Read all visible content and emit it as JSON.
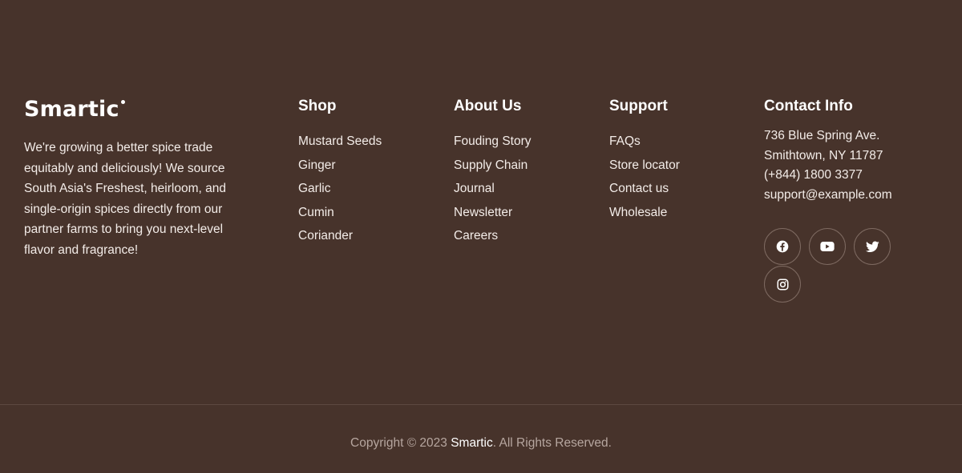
{
  "brand": {
    "logo_text": "Smartic",
    "description": "We're growing a better spice trade equitably and deliciously! We source South Asia's Freshest, heirloom, and single-origin spices directly from our partner farms to bring you next-level flavor and fragrance!"
  },
  "shop": {
    "title": "Shop",
    "items": [
      "Mustard Seeds",
      "Ginger",
      "Garlic",
      "Cumin",
      "Coriander"
    ]
  },
  "about": {
    "title": "About Us",
    "items": [
      "Fouding Story",
      "Supply Chain",
      "Journal",
      "Newsletter",
      "Careers"
    ]
  },
  "support": {
    "title": "Support",
    "items": [
      "FAQs",
      "Store locator",
      "Contact us",
      "Wholesale"
    ]
  },
  "contact": {
    "title": "Contact Info",
    "address_line1": "736 Blue Spring Ave.",
    "address_line2": "Smithtown, NY 11787",
    "phone": "(+844) 1800 3377",
    "email": "support@example.com"
  },
  "social": [
    {
      "icon": "facebook-icon"
    },
    {
      "icon": "youtube-icon"
    },
    {
      "icon": "twitter-icon"
    },
    {
      "icon": "instagram-icon"
    }
  ],
  "copyright": {
    "prefix": "Copyright © 2023 ",
    "brand": "Smartic",
    "suffix": ". All Rights Reserved."
  },
  "colors": {
    "background": "#47332b",
    "text": "#ffffff",
    "muted_text": "#b6a69f",
    "social_border": "#7e6a61",
    "divider": "#5c4840"
  }
}
